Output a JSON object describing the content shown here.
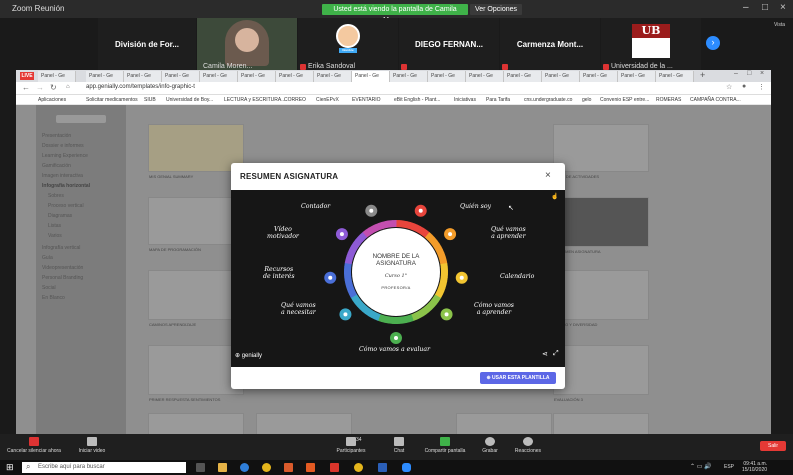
{
  "zoom": {
    "window_title": "Zoom Reunión",
    "share_banner": "Usted está viendo la pantalla de Camila Moreno",
    "view_options": "Ver Opciones",
    "participants": [
      {
        "name": "División de For...",
        "label": ""
      },
      {
        "name": "",
        "label": "Camila Moren..."
      },
      {
        "name": "",
        "label": "Erika Sandoval",
        "avatar_label": "Nombre"
      },
      {
        "name": "DIEGO FERNAN...",
        "label": ""
      },
      {
        "name": "Carmenza Mont...",
        "label": ""
      },
      {
        "name": "",
        "label": "Universidad de la ...",
        "logo_text": "UB"
      }
    ],
    "gallery_label": "Vista"
  },
  "browser": {
    "tab_label": "Panel - Ge",
    "live_label": "LIVE",
    "url": "app.genially.com/templates/info-graphic-t",
    "bookmarks": [
      "Aplicaciones",
      "Solicitar medicamentos",
      "SIUB",
      "Universidad de Boy...",
      "LECTURA y ESCRITURA...",
      "CORREO",
      "CienEPvX",
      "EVENTARIO",
      "eBit English - Plant...",
      "Iniciativas",
      "Para Tarifa",
      "cns.undergraduate.co",
      "gelo",
      "Convenio ESP entre...",
      "ROMERAS",
      "CAMPAÑA CONTRA..."
    ]
  },
  "sidebar": {
    "items": [
      "Presentación",
      "Dossier e informes",
      "Learning Experience",
      "Gamificación",
      "Imagen interactiva",
      "Infografía horizontal",
      "Sobres",
      "Proceso vertical",
      "Diagramas",
      "Listas",
      "Varios",
      "Infografía vertical",
      "Guía",
      "Videopresentación",
      "Personal Branding",
      "Social",
      "En Blanco"
    ]
  },
  "cards": [
    "MIS GENIAL SUMMARY",
    "MAPA DE PROGRAMACIÓN",
    "MAPA DE ACTIVIDADES",
    "RESUMEN ASIGNATURA",
    "CAMINOS APRENDIZAJE",
    "BANCO Y DIVERSIDAD",
    "PRIMER RESPUESTA SENTIMIENTOS",
    "EVALUACIÓN 3"
  ],
  "modal": {
    "title": "RESUMEN ASIGNATURA",
    "close": "×",
    "use_template": "USAR ESTA PLANTILLA",
    "center": {
      "title": "NOMBRE DE LA ASIGNATURA",
      "course": "Curso 1°",
      "professor": "PROFESOR/A"
    },
    "items": [
      {
        "label": "Contador",
        "color": "#8a8a8a"
      },
      {
        "label": "Quién soy",
        "color": "#e8453c"
      },
      {
        "label": "Qué vamos\na aprender",
        "color": "#f39c2a"
      },
      {
        "label": "Calendario",
        "color": "#f2c531"
      },
      {
        "label": "Cómo vamos\na aprender",
        "color": "#8bc34a"
      },
      {
        "label": "Cómo vamos a evaluar",
        "color": "#4caf50"
      },
      {
        "label": "Qué vamos\na necesitar",
        "color": "#3aa8c9"
      },
      {
        "label": "Recursos\nde interés",
        "color": "#4a6fd8"
      },
      {
        "label": "Vídeo\nmotivador",
        "color": "#8e5bd6"
      }
    ],
    "brand": "genially"
  },
  "zoom_controls": {
    "items": [
      "Cancelar silenciar ahora",
      "Iniciar video",
      "Participantes",
      "Chat",
      "Compartir pantalla",
      "Grabar",
      "Reacciones"
    ],
    "participants_count": "34",
    "stop_label": "Salir"
  },
  "taskbar": {
    "search_placeholder": "Escribe aquí para buscar",
    "lang": "ESP",
    "time": "09:41 a.m.",
    "date": "15/10/2020"
  }
}
